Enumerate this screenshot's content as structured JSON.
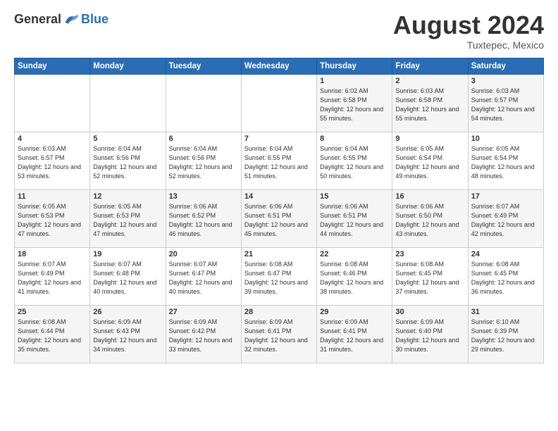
{
  "header": {
    "logo_general": "General",
    "logo_blue": "Blue",
    "month_year": "August 2024",
    "location": "Tuxtepec, Mexico"
  },
  "weekdays": [
    "Sunday",
    "Monday",
    "Tuesday",
    "Wednesday",
    "Thursday",
    "Friday",
    "Saturday"
  ],
  "weeks": [
    [
      {
        "day": "",
        "sunrise": "",
        "sunset": "",
        "daylight": ""
      },
      {
        "day": "",
        "sunrise": "",
        "sunset": "",
        "daylight": ""
      },
      {
        "day": "",
        "sunrise": "",
        "sunset": "",
        "daylight": ""
      },
      {
        "day": "",
        "sunrise": "",
        "sunset": "",
        "daylight": ""
      },
      {
        "day": "1",
        "sunrise": "Sunrise: 6:02 AM",
        "sunset": "Sunset: 6:58 PM",
        "daylight": "Daylight: 12 hours and 55 minutes."
      },
      {
        "day": "2",
        "sunrise": "Sunrise: 6:03 AM",
        "sunset": "Sunset: 6:58 PM",
        "daylight": "Daylight: 12 hours and 55 minutes."
      },
      {
        "day": "3",
        "sunrise": "Sunrise: 6:03 AM",
        "sunset": "Sunset: 6:57 PM",
        "daylight": "Daylight: 12 hours and 54 minutes."
      }
    ],
    [
      {
        "day": "4",
        "sunrise": "Sunrise: 6:03 AM",
        "sunset": "Sunset: 6:57 PM",
        "daylight": "Daylight: 12 hours and 53 minutes."
      },
      {
        "day": "5",
        "sunrise": "Sunrise: 6:04 AM",
        "sunset": "Sunset: 6:56 PM",
        "daylight": "Daylight: 12 hours and 52 minutes."
      },
      {
        "day": "6",
        "sunrise": "Sunrise: 6:04 AM",
        "sunset": "Sunset: 6:56 PM",
        "daylight": "Daylight: 12 hours and 52 minutes."
      },
      {
        "day": "7",
        "sunrise": "Sunrise: 6:04 AM",
        "sunset": "Sunset: 6:55 PM",
        "daylight": "Daylight: 12 hours and 51 minutes."
      },
      {
        "day": "8",
        "sunrise": "Sunrise: 6:04 AM",
        "sunset": "Sunset: 6:55 PM",
        "daylight": "Daylight: 12 hours and 50 minutes."
      },
      {
        "day": "9",
        "sunrise": "Sunrise: 6:05 AM",
        "sunset": "Sunset: 6:54 PM",
        "daylight": "Daylight: 12 hours and 49 minutes."
      },
      {
        "day": "10",
        "sunrise": "Sunrise: 6:05 AM",
        "sunset": "Sunset: 6:54 PM",
        "daylight": "Daylight: 12 hours and 48 minutes."
      }
    ],
    [
      {
        "day": "11",
        "sunrise": "Sunrise: 6:05 AM",
        "sunset": "Sunset: 6:53 PM",
        "daylight": "Daylight: 12 hours and 47 minutes."
      },
      {
        "day": "12",
        "sunrise": "Sunrise: 6:05 AM",
        "sunset": "Sunset: 6:53 PM",
        "daylight": "Daylight: 12 hours and 47 minutes."
      },
      {
        "day": "13",
        "sunrise": "Sunrise: 6:06 AM",
        "sunset": "Sunset: 6:52 PM",
        "daylight": "Daylight: 12 hours and 46 minutes."
      },
      {
        "day": "14",
        "sunrise": "Sunrise: 6:06 AM",
        "sunset": "Sunset: 6:51 PM",
        "daylight": "Daylight: 12 hours and 45 minutes."
      },
      {
        "day": "15",
        "sunrise": "Sunrise: 6:06 AM",
        "sunset": "Sunset: 6:51 PM",
        "daylight": "Daylight: 12 hours and 44 minutes."
      },
      {
        "day": "16",
        "sunrise": "Sunrise: 6:06 AM",
        "sunset": "Sunset: 6:50 PM",
        "daylight": "Daylight: 12 hours and 43 minutes."
      },
      {
        "day": "17",
        "sunrise": "Sunrise: 6:07 AM",
        "sunset": "Sunset: 6:49 PM",
        "daylight": "Daylight: 12 hours and 42 minutes."
      }
    ],
    [
      {
        "day": "18",
        "sunrise": "Sunrise: 6:07 AM",
        "sunset": "Sunset: 6:49 PM",
        "daylight": "Daylight: 12 hours and 41 minutes."
      },
      {
        "day": "19",
        "sunrise": "Sunrise: 6:07 AM",
        "sunset": "Sunset: 6:48 PM",
        "daylight": "Daylight: 12 hours and 40 minutes."
      },
      {
        "day": "20",
        "sunrise": "Sunrise: 6:07 AM",
        "sunset": "Sunset: 6:47 PM",
        "daylight": "Daylight: 12 hours and 40 minutes."
      },
      {
        "day": "21",
        "sunrise": "Sunrise: 6:08 AM",
        "sunset": "Sunset: 6:47 PM",
        "daylight": "Daylight: 12 hours and 39 minutes."
      },
      {
        "day": "22",
        "sunrise": "Sunrise: 6:08 AM",
        "sunset": "Sunset: 6:46 PM",
        "daylight": "Daylight: 12 hours and 38 minutes."
      },
      {
        "day": "23",
        "sunrise": "Sunrise: 6:08 AM",
        "sunset": "Sunset: 6:45 PM",
        "daylight": "Daylight: 12 hours and 37 minutes."
      },
      {
        "day": "24",
        "sunrise": "Sunrise: 6:08 AM",
        "sunset": "Sunset: 6:45 PM",
        "daylight": "Daylight: 12 hours and 36 minutes."
      }
    ],
    [
      {
        "day": "25",
        "sunrise": "Sunrise: 6:08 AM",
        "sunset": "Sunset: 6:44 PM",
        "daylight": "Daylight: 12 hours and 35 minutes."
      },
      {
        "day": "26",
        "sunrise": "Sunrise: 6:09 AM",
        "sunset": "Sunset: 6:43 PM",
        "daylight": "Daylight: 12 hours and 34 minutes."
      },
      {
        "day": "27",
        "sunrise": "Sunrise: 6:09 AM",
        "sunset": "Sunset: 6:42 PM",
        "daylight": "Daylight: 12 hours and 33 minutes."
      },
      {
        "day": "28",
        "sunrise": "Sunrise: 6:09 AM",
        "sunset": "Sunset: 6:41 PM",
        "daylight": "Daylight: 12 hours and 32 minutes."
      },
      {
        "day": "29",
        "sunrise": "Sunrise: 6:09 AM",
        "sunset": "Sunset: 6:41 PM",
        "daylight": "Daylight: 12 hours and 31 minutes."
      },
      {
        "day": "30",
        "sunrise": "Sunrise: 6:09 AM",
        "sunset": "Sunset: 6:40 PM",
        "daylight": "Daylight: 12 hours and 30 minutes."
      },
      {
        "day": "31",
        "sunrise": "Sunrise: 6:10 AM",
        "sunset": "Sunset: 6:39 PM",
        "daylight": "Daylight: 12 hours and 29 minutes."
      }
    ]
  ]
}
